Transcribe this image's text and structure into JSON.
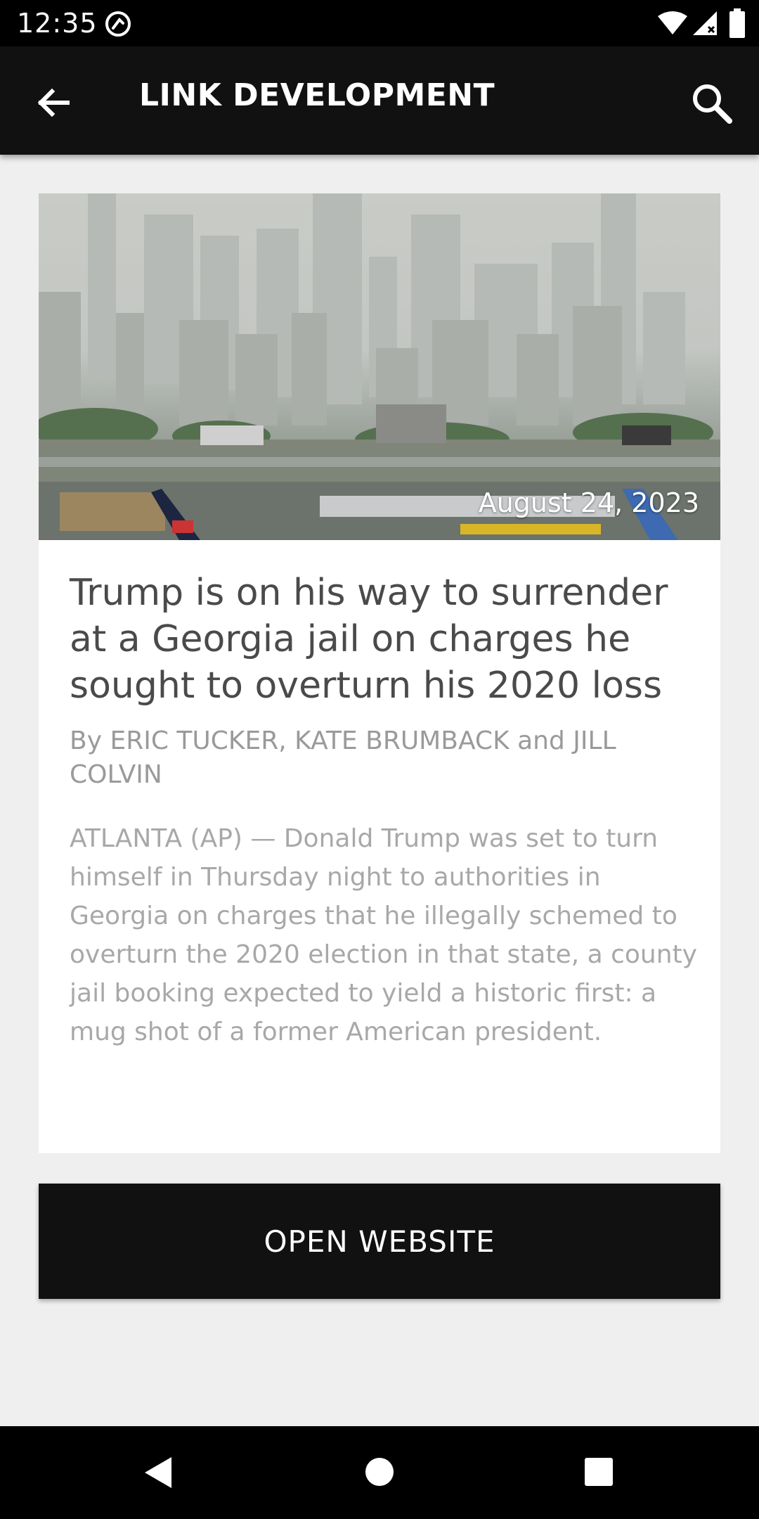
{
  "status_bar": {
    "time": "12:35",
    "icons": [
      "app-notification-icon",
      "wifi-icon",
      "signal-icon",
      "battery-icon"
    ]
  },
  "app_bar": {
    "title": "LINK DEVELOPMENT",
    "back_icon": "arrow-back-icon",
    "search_icon": "search-icon",
    "background": "#111111"
  },
  "article": {
    "date": "August 24, 2023",
    "headline": "Trump is on his way to surrender at a Georgia jail on charges he sought to overturn his 2020 loss",
    "byline": "By ERIC TUCKER, KATE BRUMBACK and JILL COLVIN",
    "summary": "ATLANTA (AP) — Donald Trump was set to turn himself in Thursday night to authorities in Georgia on charges that he illegally schemed to overturn the 2020 election in that state, a county jail booking expected to yield a historic first: a mug shot of a former American president."
  },
  "actions": {
    "open_website_label": "OPEN WEBSITE"
  },
  "nav_bar": {
    "icons": [
      "nav-back-icon",
      "nav-home-icon",
      "nav-recents-icon"
    ]
  }
}
